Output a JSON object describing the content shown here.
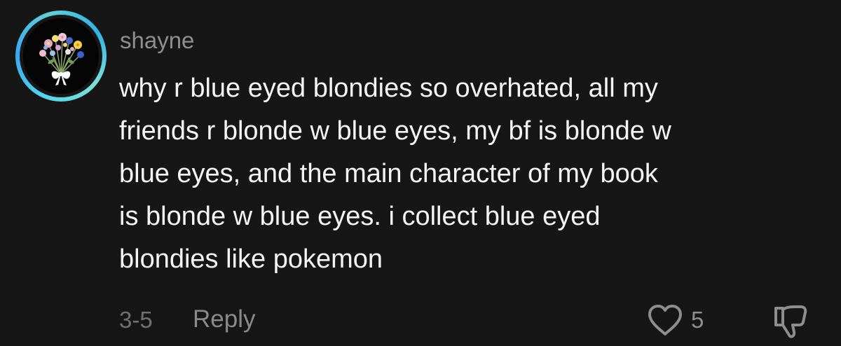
{
  "comment": {
    "username": "shayne",
    "text_lines": [
      "why r blue eyed blondies so overhated, all my",
      "friends r blonde w blue eyes, my bf is blonde w",
      "blue eyes, and the main character of my book",
      "is blonde w blue eyes. i collect blue eyed",
      "blondies like pokemon"
    ],
    "date": "3-5",
    "reply_label": "Reply",
    "like_count": "5",
    "icons": {
      "avatar": "flower-bouquet-avatar",
      "like": "heart-outline-icon",
      "dislike": "thumbs-down-icon"
    },
    "colors": {
      "background": "#161616",
      "avatar_ring": "#3aa7f0",
      "username": "#8e8e8e",
      "text": "#f4f4f4",
      "muted": "#8a8a8a"
    }
  }
}
